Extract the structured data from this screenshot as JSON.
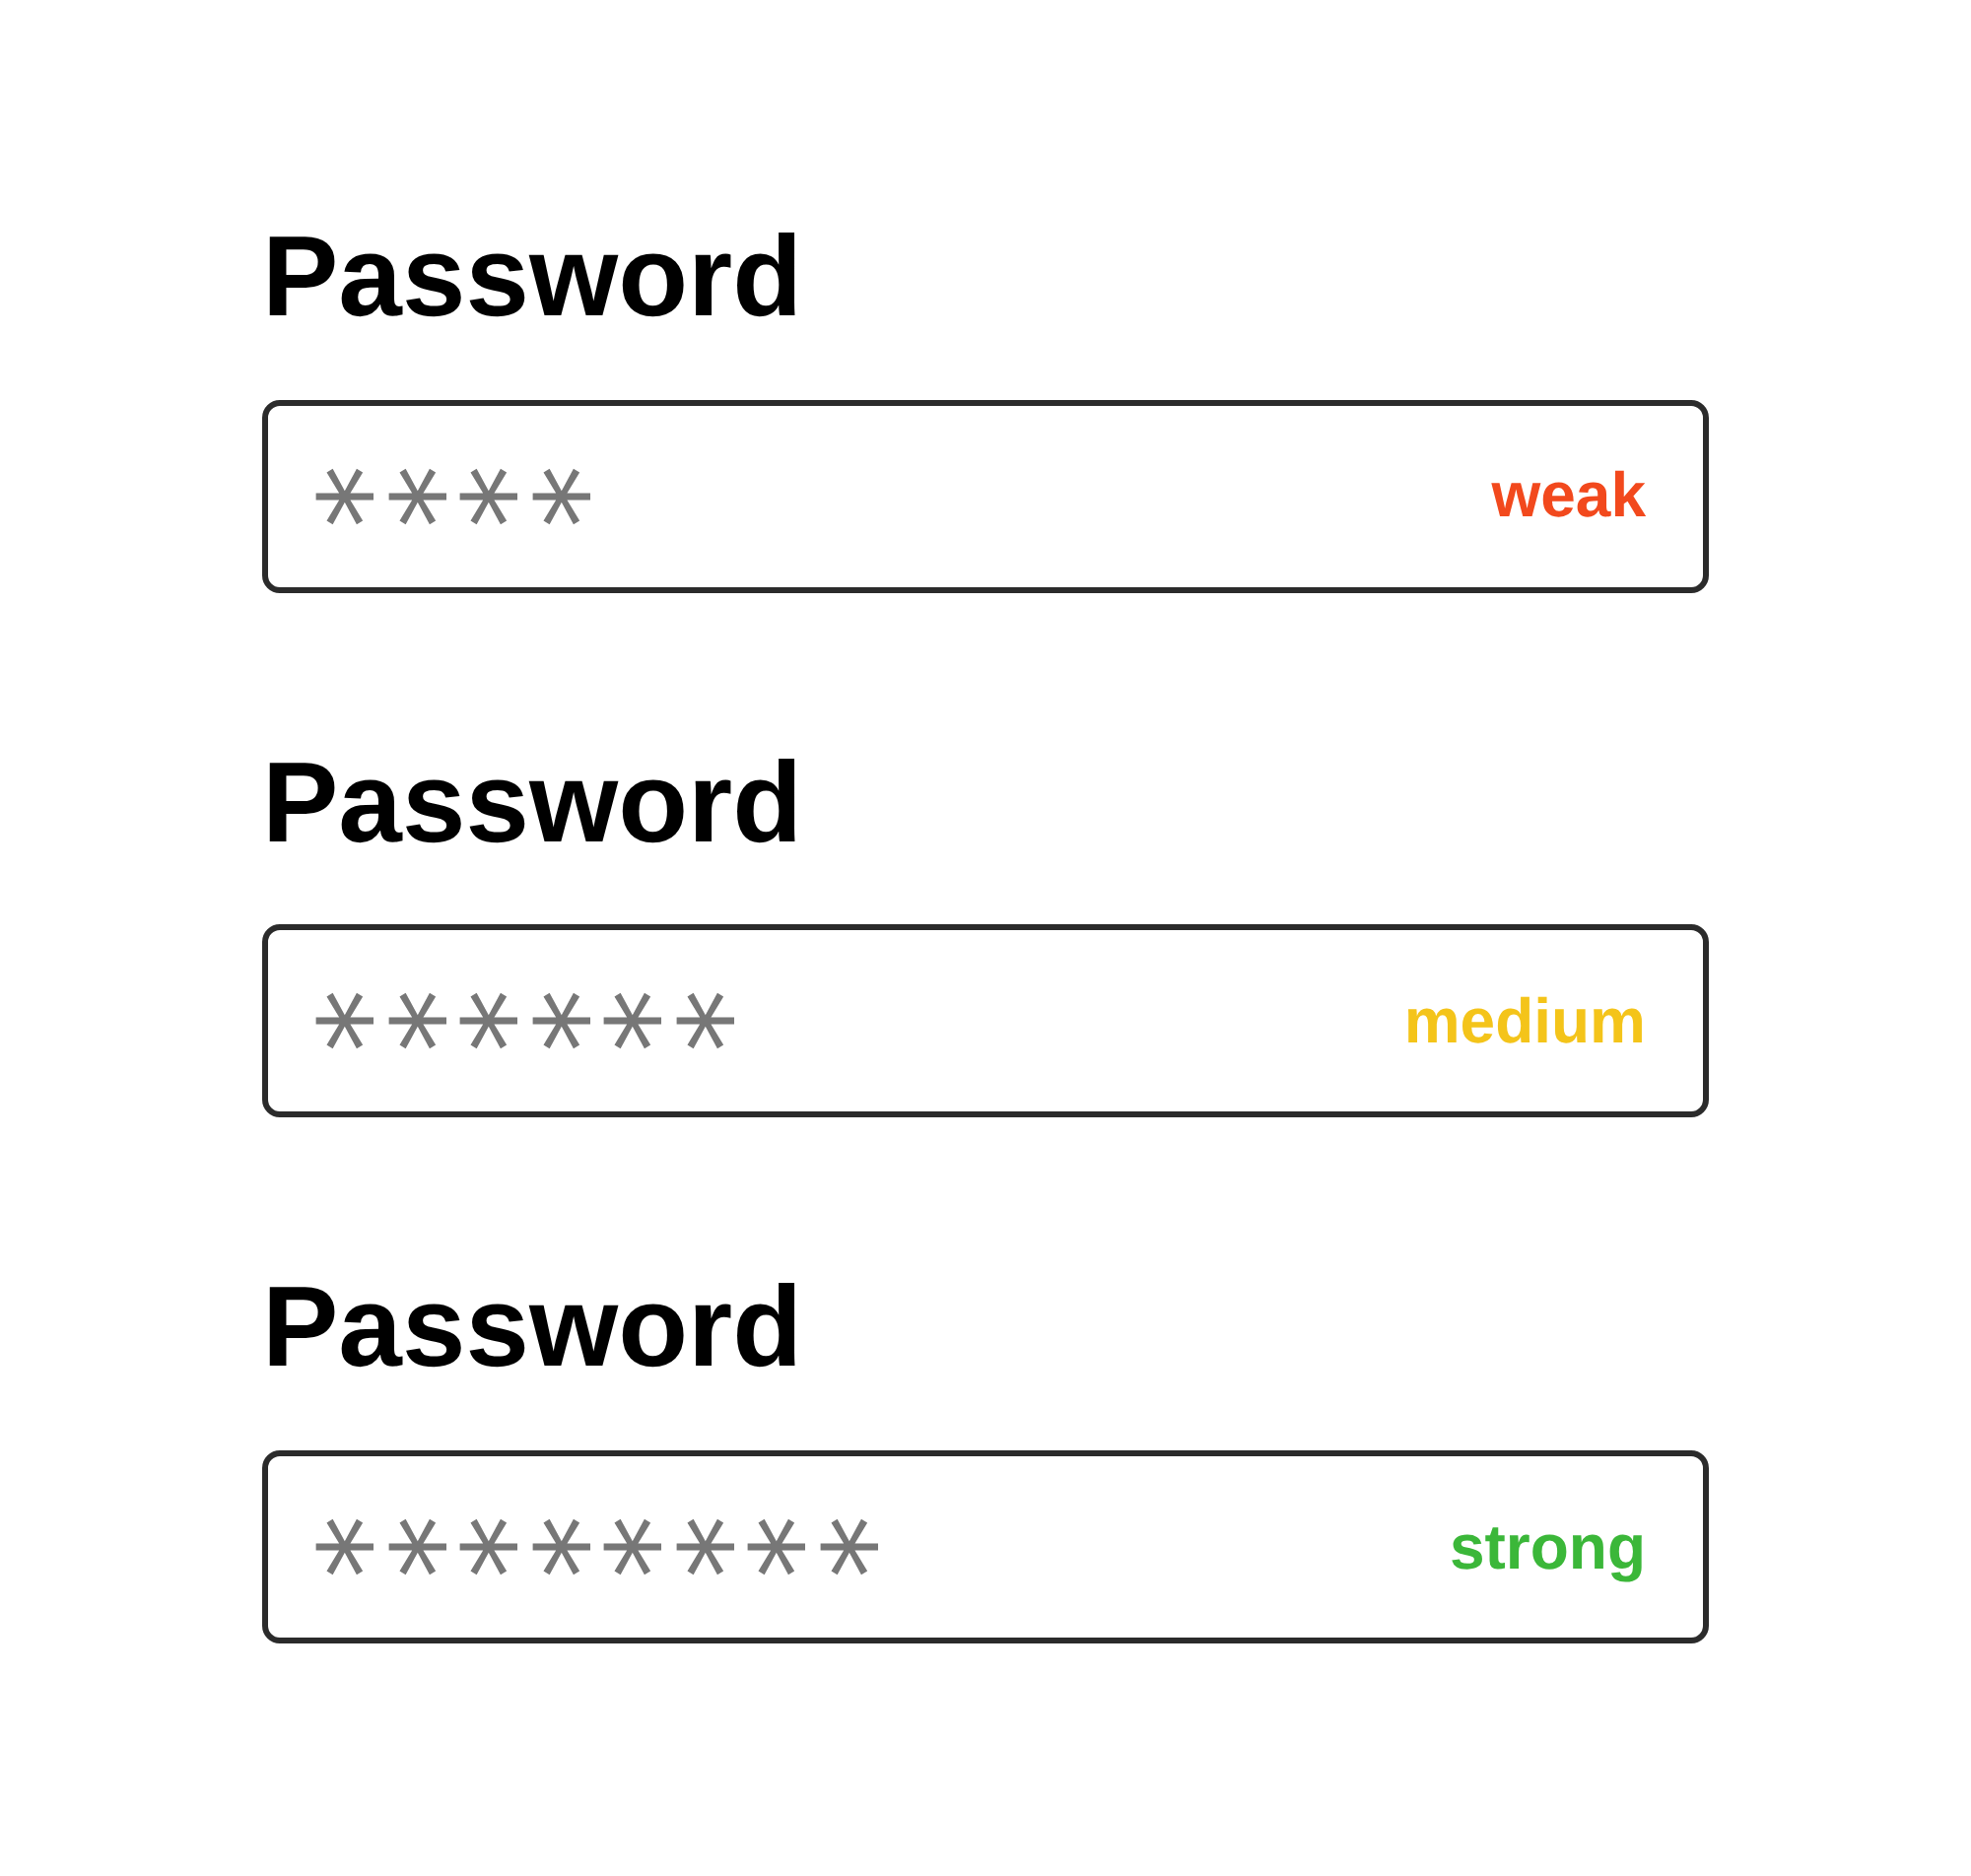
{
  "fields": [
    {
      "label": "Password",
      "value": "****",
      "strength": "weak",
      "color": "#f2491d"
    },
    {
      "label": "Password",
      "value": "******",
      "strength": "medium",
      "color": "#f4c41a"
    },
    {
      "label": "Password",
      "value": "********",
      "strength": "strong",
      "color": "#3bb739"
    }
  ]
}
